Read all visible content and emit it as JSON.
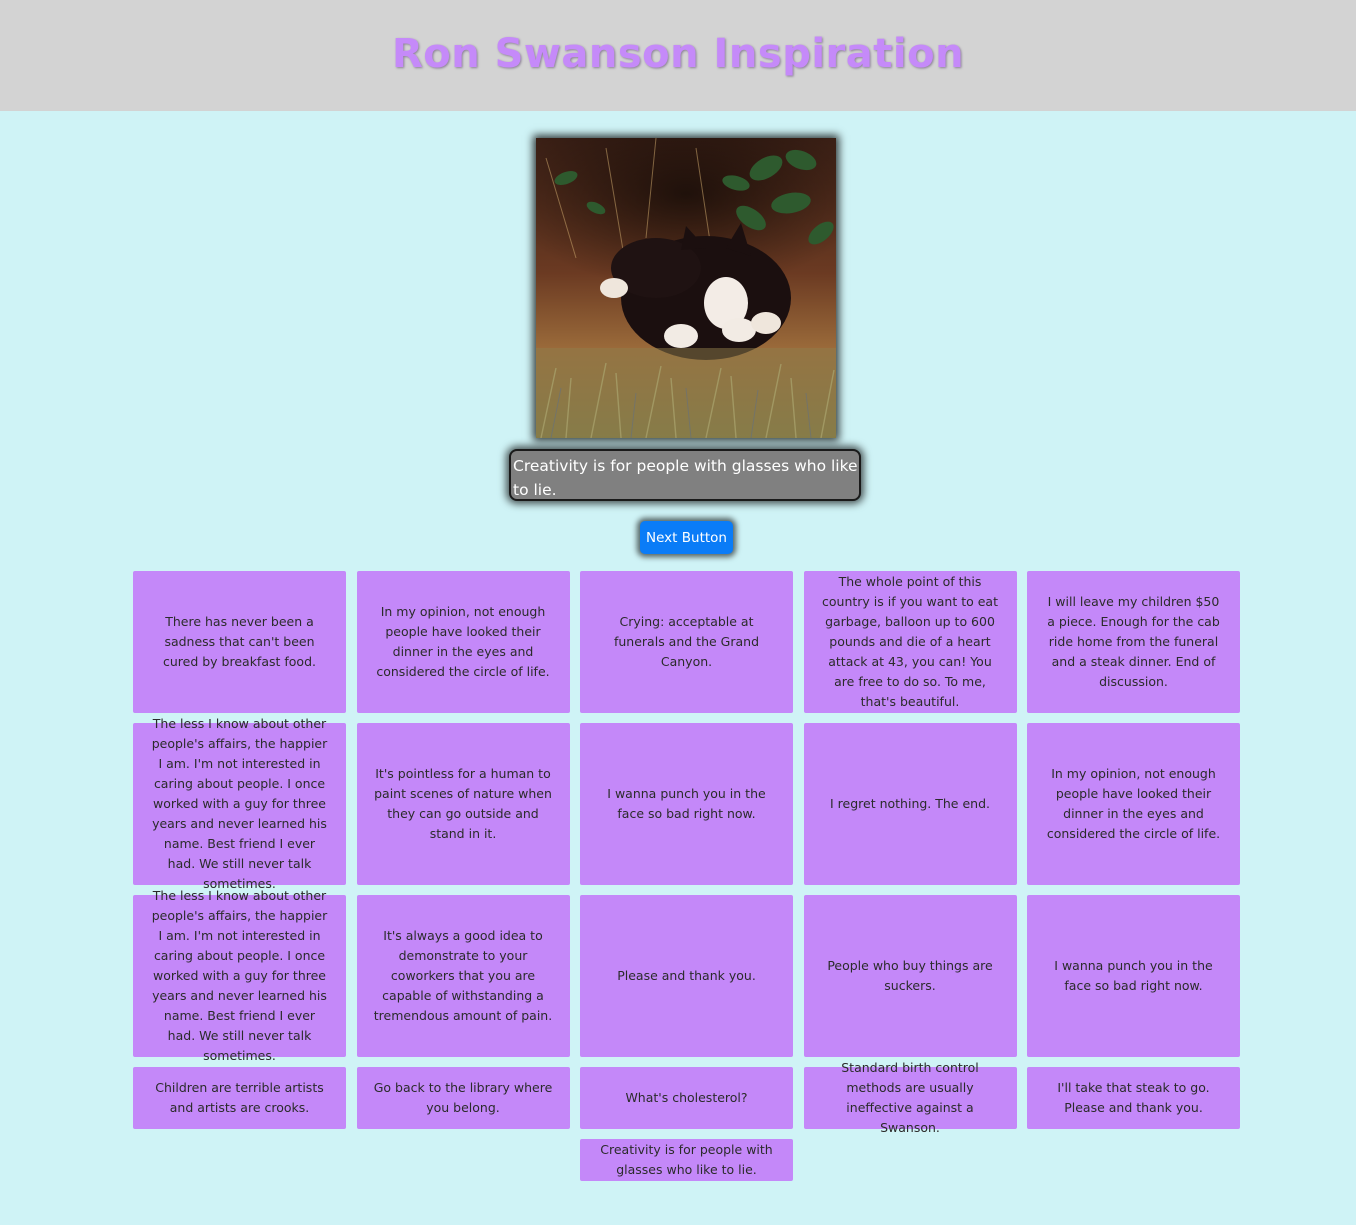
{
  "header": {
    "title": "Ron Swanson Inspiration"
  },
  "photo": {
    "alt": "cat-in-garden-image"
  },
  "current_quote": "Creativity is for people with glasses who like to lie.",
  "next_button_label": "Next Button",
  "cards": [
    "There has never been a sadness that can't been cured by breakfast food.",
    "In my opinion, not enough people have looked their dinner in the eyes and considered the circle of life.",
    "Crying: acceptable at funerals and the Grand Canyon.",
    "The whole point of this country is if you want to eat garbage, balloon up to 600 pounds and die of a heart attack at 43, you can! You are free to do so. To me, that's beautiful.",
    "I will leave my children $50 a piece. Enough for the cab ride home from the funeral and a steak dinner. End of discussion.",
    "The less I know about other people's affairs, the happier I am. I'm not interested in caring about people. I once worked with a guy for three years and never learned his name. Best friend I ever had. We still never talk sometimes.",
    "It's pointless for a human to paint scenes of nature when they can go outside and stand in it.",
    "I wanna punch you in the face so bad right now.",
    "I regret nothing. The end.",
    "In my opinion, not enough people have looked their dinner in the eyes and considered the circle of life.",
    "The less I know about other people's affairs, the happier I am. I'm not interested in caring about people. I once worked with a guy for three years and never learned his name. Best friend I ever had. We still never talk sometimes.",
    "It's always a good idea to demonstrate to your coworkers that you are capable of withstanding a tremendous amount of pain.",
    "Please and thank you.",
    "People who buy things are suckers.",
    "I wanna punch you in the face so bad right now.",
    "Children are terrible artists and artists are crooks.",
    "Go back to the library where you belong.",
    "What's cholesterol?",
    "Standard birth control methods are usually ineffective against a Swanson.",
    "I'll take that steak to go. Please and thank you.",
    "Creativity is for people with glasses who like to lie."
  ]
}
